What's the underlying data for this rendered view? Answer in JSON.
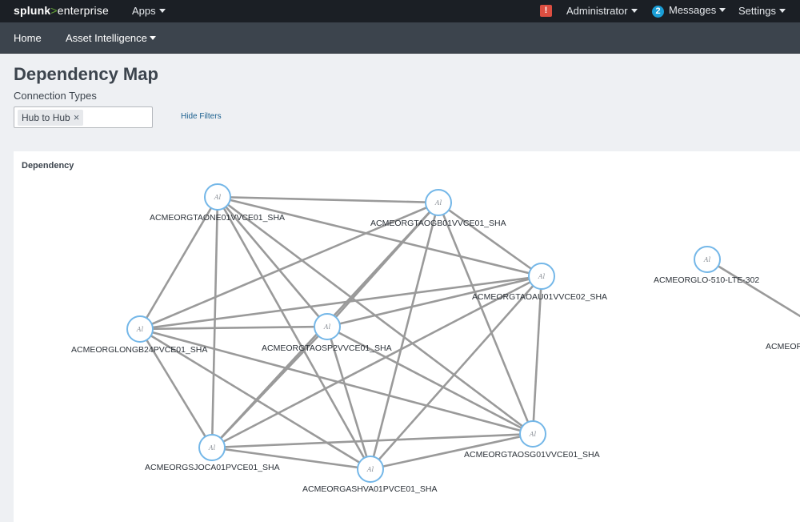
{
  "topbar": {
    "logo": {
      "word": "splunk",
      "symbol": ">",
      "product": "enterprise"
    },
    "apps_label": "Apps",
    "alert_icon_glyph": "!",
    "admin_label": "Administrator",
    "messages_count": "2",
    "messages_label": "Messages",
    "settings_label": "Settings"
  },
  "navbar": {
    "home_label": "Home",
    "asset_intel_label": "Asset Intelligence"
  },
  "page": {
    "title": "Dependency Map",
    "filter_label": "Connection Types",
    "filter_chip": "Hub to Hub",
    "chip_remove_glyph": "×",
    "hide_filters_label": "Hide Filters"
  },
  "panel": {
    "title": "Dependency",
    "node_icon_glyph": "Al",
    "node_color": "#74b7e8",
    "edge_color": "#9a9a9a",
    "nodes": [
      {
        "id": "one",
        "label": "ACMEORGTAONE01VVCE01_SHA"
      },
      {
        "id": "gb",
        "label": "ACMEORGTAOGB01VVCE01_SHA"
      },
      {
        "id": "au",
        "label": "ACMEORGTAOAU01VVCE02_SHA"
      },
      {
        "id": "long",
        "label": "ACMEORGLONGB24PVCE01_SHA"
      },
      {
        "id": "sp2",
        "label": "ACMEORGTAOSP2VVCE01_SHA"
      },
      {
        "id": "sg",
        "label": "ACMEORGTAOSG01VVCE01_SHA"
      },
      {
        "id": "sjo",
        "label": "ACMEORGSJOCA01PVCE01_SHA"
      },
      {
        "id": "ashva",
        "label": "ACMEORGASHVA01PVCE01_SHA"
      },
      {
        "id": "lte",
        "label": "ACMEORGLO-510-LTE-302"
      },
      {
        "id": "cut",
        "label": "ACMEOR"
      }
    ],
    "edges": [
      [
        "one",
        "gb"
      ],
      [
        "one",
        "au"
      ],
      [
        "one",
        "long"
      ],
      [
        "one",
        "sp2"
      ],
      [
        "one",
        "sg"
      ],
      [
        "one",
        "sjo"
      ],
      [
        "one",
        "ashva"
      ],
      [
        "gb",
        "au"
      ],
      [
        "gb",
        "long"
      ],
      [
        "gb",
        "sp2"
      ],
      [
        "gb",
        "sg"
      ],
      [
        "gb",
        "sjo"
      ],
      [
        "gb",
        "ashva"
      ],
      [
        "au",
        "long"
      ],
      [
        "au",
        "sp2"
      ],
      [
        "au",
        "sg"
      ],
      [
        "au",
        "sjo"
      ],
      [
        "au",
        "ashva"
      ],
      [
        "long",
        "sp2"
      ],
      [
        "long",
        "sg"
      ],
      [
        "long",
        "sjo"
      ],
      [
        "long",
        "ashva"
      ],
      [
        "sp2",
        "sg"
      ],
      [
        "sp2",
        "sjo"
      ],
      [
        "sp2",
        "ashva"
      ],
      [
        "sg",
        "sjo"
      ],
      [
        "sg",
        "ashva"
      ],
      [
        "sjo",
        "ashva"
      ],
      [
        "lte",
        "offscreen"
      ]
    ]
  }
}
